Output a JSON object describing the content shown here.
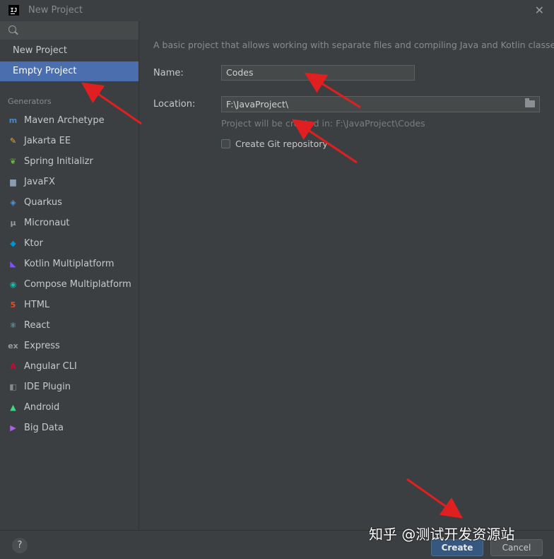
{
  "window": {
    "app_icon_text": "IJ",
    "title": "New Project",
    "close_glyph": "✕"
  },
  "sidebar": {
    "search_placeholder": "",
    "top_items": [
      {
        "label": "New Project",
        "selected": false
      },
      {
        "label": "Empty Project",
        "selected": true
      }
    ],
    "generators_heading": "Generators",
    "generators": [
      {
        "label": "Maven Archetype",
        "icon": "maven-icon",
        "glyph": "m",
        "color": "#4a87c8"
      },
      {
        "label": "Jakarta EE",
        "icon": "jakarta-icon",
        "glyph": "✎",
        "color": "#f5a623"
      },
      {
        "label": "Spring Initializr",
        "icon": "spring-icon",
        "glyph": "❦",
        "color": "#6db33f"
      },
      {
        "label": "JavaFX",
        "icon": "javafx-icon",
        "glyph": "▆",
        "color": "#8a9bb0"
      },
      {
        "label": "Quarkus",
        "icon": "quarkus-icon",
        "glyph": "◈",
        "color": "#4695eb"
      },
      {
        "label": "Micronaut",
        "icon": "micronaut-icon",
        "glyph": "μ",
        "color": "#9a9a9a"
      },
      {
        "label": "Ktor",
        "icon": "ktor-icon",
        "glyph": "◆",
        "color": "#0095d5"
      },
      {
        "label": "Kotlin Multiplatform",
        "icon": "kotlin-icon",
        "glyph": "◣",
        "color": "#7f52ff"
      },
      {
        "label": "Compose Multiplatform",
        "icon": "compose-icon",
        "glyph": "◉",
        "color": "#21b5a8"
      },
      {
        "label": "HTML",
        "icon": "html5-icon",
        "glyph": "5",
        "color": "#e44d26"
      },
      {
        "label": "React",
        "icon": "react-icon",
        "glyph": "⚛",
        "color": "#61dafb"
      },
      {
        "label": "Express",
        "icon": "express-icon",
        "glyph": "ex",
        "color": "#9a9a9a"
      },
      {
        "label": "Angular CLI",
        "icon": "angular-icon",
        "glyph": "A",
        "color": "#dd0031"
      },
      {
        "label": "IDE Plugin",
        "icon": "plugin-icon",
        "glyph": "◧",
        "color": "#8a8a8a"
      },
      {
        "label": "Android",
        "icon": "android-icon",
        "glyph": "▲",
        "color": "#3ddc84"
      },
      {
        "label": "Big Data",
        "icon": "bigdata-icon",
        "glyph": "▶",
        "color": "#b35cf0"
      }
    ]
  },
  "main": {
    "description": "A basic project that allows working with separate files and compiling Java and Kotlin classes.",
    "name_label": "Name:",
    "name_value": "Codes",
    "location_label": "Location:",
    "location_value": "F:\\JavaProject\\",
    "location_hint": "Project will be created in: F:\\JavaProject\\Codes",
    "git_checkbox_label": "Create Git repository",
    "git_checked": false
  },
  "footer": {
    "help_label": "?",
    "create_label": "Create",
    "cancel_label": "Cancel"
  },
  "watermark": "知乎 @测试开发资源站",
  "annotation_color": "#e02020"
}
